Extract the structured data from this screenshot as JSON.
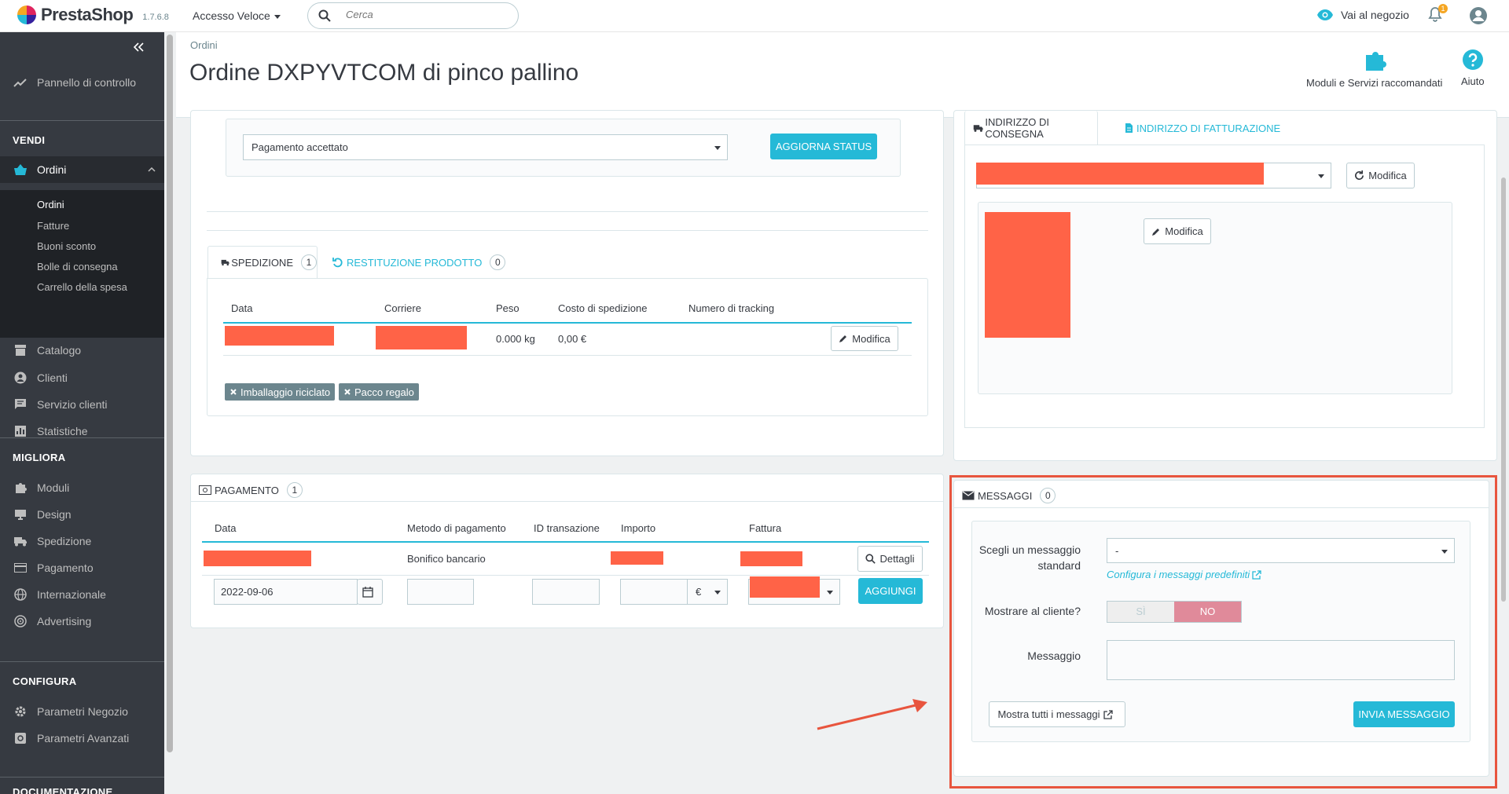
{
  "topbar": {
    "brand": "PrestaShop",
    "version": "1.7.6.8",
    "quick_access": "Accesso Veloce",
    "search_placeholder": "Cerca",
    "view_shop": "Vai al negozio",
    "notifications_count": "1"
  },
  "sidebar": {
    "dashboard": "Pannello di controllo",
    "sections": {
      "sell": "VENDI",
      "improve": "MIGLIORA",
      "configure": "CONFIGURA",
      "doc": "DOCUMENTAZIONE"
    },
    "sell_items": [
      "Ordini",
      "Catalogo",
      "Clienti",
      "Servizio clienti",
      "Statistiche"
    ],
    "orders_sub": [
      "Ordini",
      "Fatture",
      "Buoni sconto",
      "Bolle di consegna",
      "Carrello della spesa"
    ],
    "improve_items": [
      "Moduli",
      "Design",
      "Spedizione",
      "Pagamento",
      "Internazionale",
      "Advertising"
    ],
    "configure_items": [
      "Parametri Negozio",
      "Parametri Avanzati"
    ]
  },
  "header": {
    "breadcrumb": "Ordini",
    "title": "Ordine DXPYVTCOM di pinco pallino",
    "toolbar": {
      "modules": "Moduli e Servizi raccomandati",
      "help": "Aiuto"
    }
  },
  "status": {
    "selected": "Pagamento accettato",
    "update_button": "AGGIORNA STATUS"
  },
  "shipping": {
    "tab_shipping": "SPEDIZIONE",
    "tab_shipping_count": "1",
    "tab_return": "RESTITUZIONE PRODOTTO",
    "tab_return_count": "0",
    "columns": [
      "Data",
      "Corriere",
      "Peso",
      "Costo di spedizione",
      "Numero di tracking"
    ],
    "row": {
      "weight": "0.000 kg",
      "cost": "0,00 €",
      "edit": "Modifica"
    },
    "tags": [
      "Imballaggio riciclato",
      "Pacco regalo"
    ]
  },
  "payment": {
    "title": "PAGAMENTO",
    "count": "1",
    "columns": [
      "Data",
      "Metodo di pagamento",
      "ID transazione",
      "Importo",
      "Fattura"
    ],
    "row": {
      "method": "Bonifico bancario",
      "details": "Dettagli"
    },
    "form": {
      "date": "2022-09-06",
      "currency": "€",
      "add": "AGGIUNGI"
    }
  },
  "address": {
    "tab_delivery": "INDIRIZZO DI CONSEGNA",
    "tab_invoice": "INDIRIZZO DI FATTURAZIONE",
    "edit_select": "Modifica",
    "edit_address": "Modifica"
  },
  "messages": {
    "title": "MESSAGGI",
    "count": "0",
    "label_standard": "Scegli un messaggio standard",
    "standard_selected": "-",
    "configure_link": "Configura i messaggi predefiniti",
    "label_show": "Mostrare al cliente?",
    "yes": "SÌ",
    "no": "NO",
    "label_message": "Messaggio",
    "show_all": "Mostra tutti i messaggi",
    "send": "INVIA MESSAGGIO"
  },
  "colors": {
    "accent": "#25b9d7",
    "sidebar": "#363a41",
    "redacted": "#ff6347",
    "highlight": "#e8553e"
  }
}
